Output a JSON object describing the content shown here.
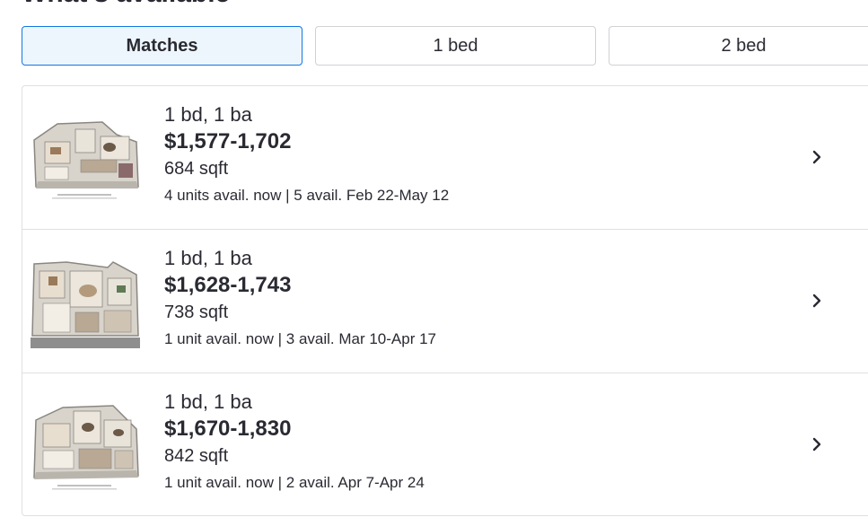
{
  "section": {
    "title": "What's available"
  },
  "tabs": [
    {
      "label": "Matches",
      "active": true
    },
    {
      "label": "1 bed",
      "active": false
    },
    {
      "label": "2 bed",
      "active": false
    }
  ],
  "floorplans": [
    {
      "beds_baths": "1 bd, 1 ba",
      "price": "$1,577-1,702",
      "sqft": "684 sqft",
      "availability": "4 units avail. now | 5 avail. Feb 22-May 12",
      "image_icon": "floorplan-image"
    },
    {
      "beds_baths": "1 bd, 1 ba",
      "price": "$1,628-1,743",
      "sqft": "738 sqft",
      "availability": "1 unit avail. now | 3 avail. Mar 10-Apr 17",
      "image_icon": "floorplan-image"
    },
    {
      "beds_baths": "1 bd, 1 ba",
      "price": "$1,670-1,830",
      "sqft": "842 sqft",
      "availability": "1 unit avail. now | 2 avail. Apr 7-Apr 24",
      "image_icon": "floorplan-image"
    }
  ],
  "icons": {
    "row_action": "chevron-right-icon"
  },
  "colors": {
    "accent": "#1277e1",
    "active_tab_bg": "#eef6fd",
    "text": "#2a2a33",
    "border": "#d1d1d5"
  }
}
